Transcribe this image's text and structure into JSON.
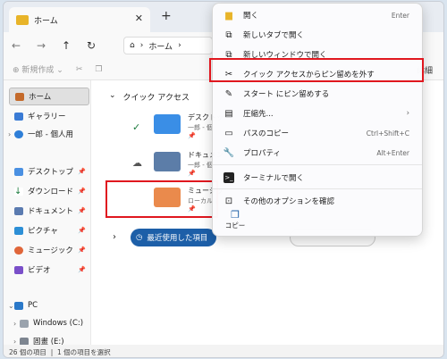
{
  "tab": {
    "title": "ホーム",
    "close": "✕",
    "new": "+"
  },
  "address": {
    "crumb": "ホーム"
  },
  "cmdbar": {
    "new_label": "新規作成",
    "detail": "詳細"
  },
  "sidebar": {
    "home": "ホーム",
    "gallery": "ギャラリー",
    "personal": "一郎 - 個人用",
    "desktop": "デスクトップ",
    "downloads": "ダウンロード",
    "documents": "ドキュメント",
    "pictures": "ピクチャ",
    "music": "ミュージック",
    "videos": "ビデオ",
    "pc": "PC",
    "windows": "Windows (C:)",
    "drive_e": "固畫 (E:)"
  },
  "main": {
    "quick_access": "クイック アクセス",
    "items": [
      {
        "name": "デスクトッ",
        "sub": "一郎 - 個"
      },
      {
        "name": "ドキュメン",
        "sub": "一郎 - 個"
      },
      {
        "name": "ミュージッ",
        "sub": "ローカル ("
      }
    ],
    "recent": "最近使用した項目",
    "pill2": ""
  },
  "status": {
    "count": "26 個の項目",
    "selected": "1 個の項目を選択"
  },
  "menu": {
    "open": "開く",
    "open_sc": "Enter",
    "new_tab": "新しいタブで開く",
    "new_window": "新しいウィンドウで開く",
    "unpin_quick": "クイック アクセスからピン留めを外す",
    "pin_start": "スタート にピン留めする",
    "compress": "圧縮先...",
    "copy_path": "パスのコピー",
    "copy_path_sc": "Ctrl+Shift+C",
    "properties": "プロパティ",
    "properties_sc": "Alt+Enter",
    "terminal": "ターミナルで開く",
    "more_options": "その他のオプションを確認",
    "copy": "コピー"
  },
  "colors": {
    "accent": "#1d5fa8",
    "highlight": "#e0171f",
    "folder": "#e8b429"
  }
}
